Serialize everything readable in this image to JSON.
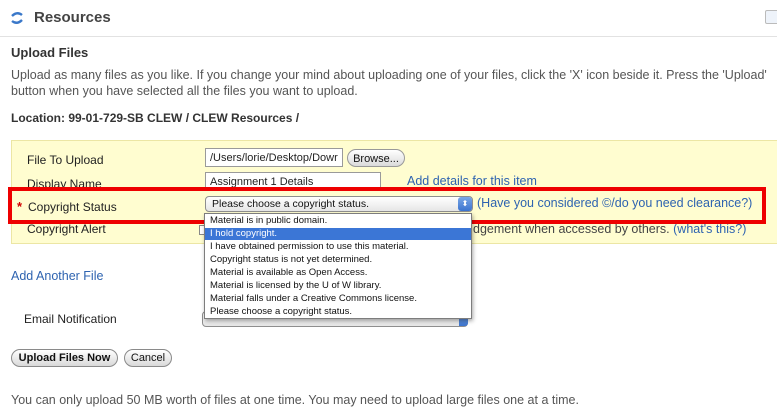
{
  "header": {
    "title": "Resources",
    "icon": "resources-swirl-icon"
  },
  "upload": {
    "title": "Upload Files",
    "intro": "Upload as many files as you like. If you change your mind about uploading one of your files, click the 'X' icon beside it. Press the 'Upload' button when you have selected all the files you want to upload.",
    "location": "Location: 99-01-729-SB CLEW / CLEW Resources /"
  },
  "form": {
    "file_label": "File To Upload",
    "file_value": "/Users/lorie/Desktop/Dowr",
    "browse_label": "Browse...",
    "display_label": "Display Name",
    "display_value": "Assignment 1 Details",
    "details_link": "Add details for this item",
    "required_mark": "*",
    "copyright_label": "Copyright Status",
    "copyright_selected": "Please choose a copyright status.",
    "clearance_link": "(Have you considered ©/do you need clearance?)",
    "copyright_options": [
      "Material is in public domain.",
      "I hold copyright.",
      "I have obtained permission to use this material.",
      "Copyright status is not yet determined.",
      "Material is available as Open Access.",
      "Material is licensed by the U of W library.",
      "Material falls under a Creative Commons license.",
      "Please choose a copyright status."
    ],
    "highlighted_option_index": 1,
    "alert_label": "Copyright Alert",
    "alert_text_tail": "dgement when accessed by others.",
    "alert_help_link": "(what's this?)"
  },
  "add_file_link": "Add Another File",
  "email_label": "Email Notification",
  "buttons": {
    "upload": "Upload Files Now",
    "cancel": "Cancel"
  },
  "footer_note": "You can only upload 50 MB worth of files at one time. You may need to upload large files one at a time.",
  "colors": {
    "panel": "#fffdd0",
    "link": "#2e63b0",
    "highlight": "#ee0000",
    "selection": "#3b76d6"
  }
}
